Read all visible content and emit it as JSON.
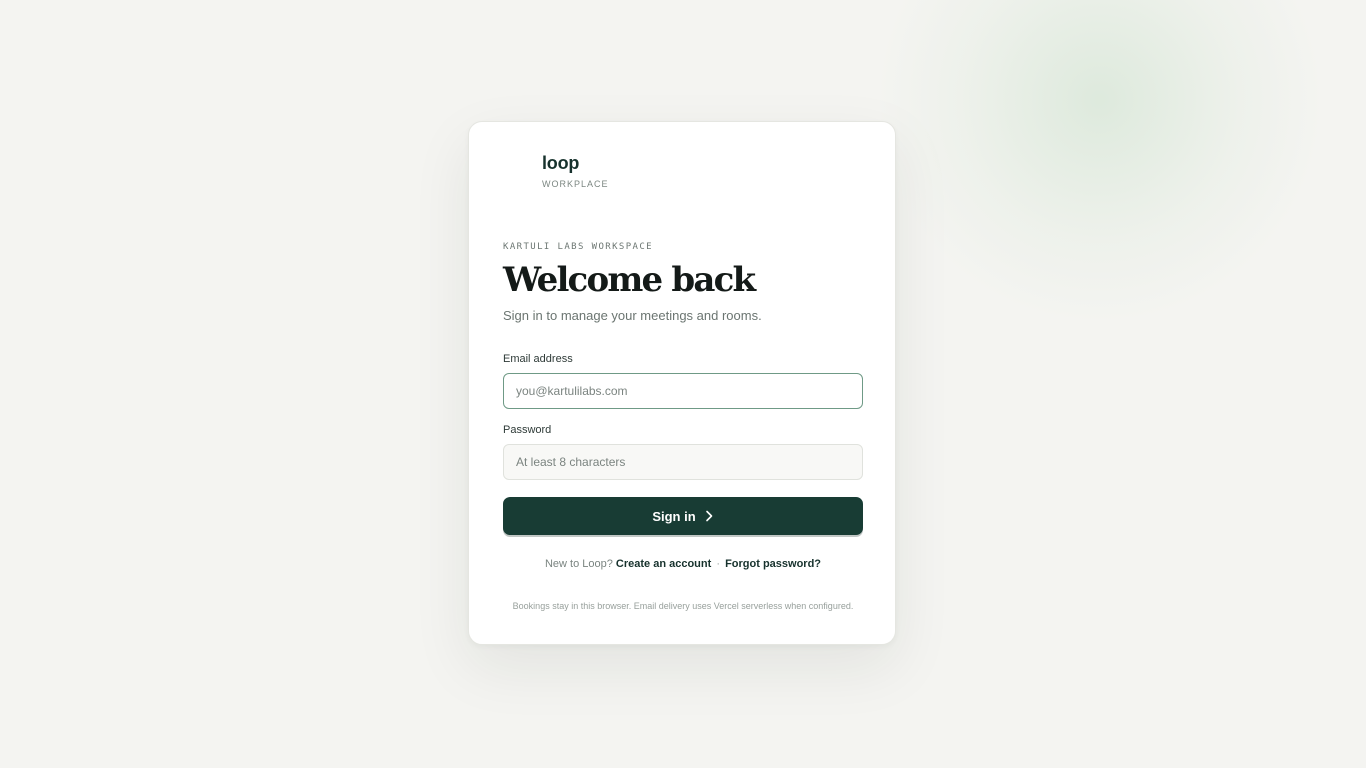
{
  "brand": {
    "name": "loop",
    "subtitle": "WORKPLACE"
  },
  "login": {
    "eyebrow": "KARTULI LABS WORKSPACE",
    "title": "Welcome back",
    "subtitle": "Sign in to manage your meetings and rooms.",
    "email": {
      "label": "Email address",
      "value": "",
      "placeholder": "you@kartulilabs.com"
    },
    "password": {
      "label": "Password",
      "value": "",
      "placeholder": "At least 8 characters"
    },
    "submit_label": "Sign in",
    "submit_icon": "chevron-right-icon",
    "prompt": "New to Loop?",
    "create_account_label": "Create an account",
    "separator": "·",
    "forgot_password_label": "Forgot password?",
    "footnote": "Bookings stay in this browser. Email delivery uses Vercel serverless when configured."
  },
  "colors": {
    "background": "#f4f4f1",
    "card": "#ffffff",
    "primary": "#183c34",
    "focus_border": "#6f9a86",
    "heading": "#141a18"
  }
}
